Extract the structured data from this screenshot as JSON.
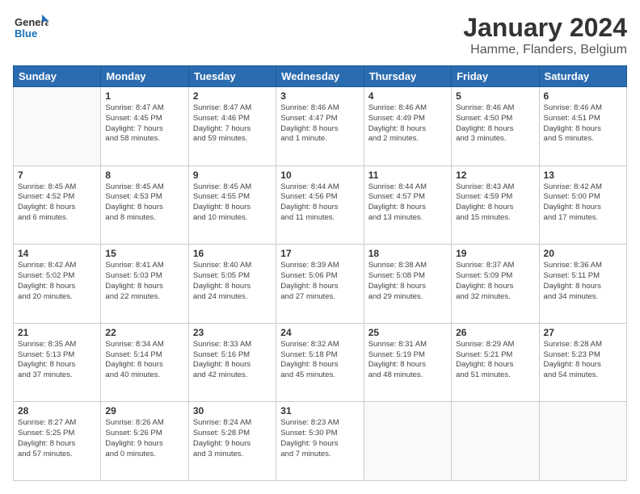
{
  "header": {
    "logo_general": "General",
    "logo_blue": "Blue",
    "title": "January 2024",
    "subtitle": "Hamme, Flanders, Belgium"
  },
  "days_of_week": [
    "Sunday",
    "Monday",
    "Tuesday",
    "Wednesday",
    "Thursday",
    "Friday",
    "Saturday"
  ],
  "weeks": [
    [
      {
        "day": "",
        "detail": ""
      },
      {
        "day": "1",
        "detail": "Sunrise: 8:47 AM\nSunset: 4:45 PM\nDaylight: 7 hours\nand 58 minutes."
      },
      {
        "day": "2",
        "detail": "Sunrise: 8:47 AM\nSunset: 4:46 PM\nDaylight: 7 hours\nand 59 minutes."
      },
      {
        "day": "3",
        "detail": "Sunrise: 8:46 AM\nSunset: 4:47 PM\nDaylight: 8 hours\nand 1 minute."
      },
      {
        "day": "4",
        "detail": "Sunrise: 8:46 AM\nSunset: 4:49 PM\nDaylight: 8 hours\nand 2 minutes."
      },
      {
        "day": "5",
        "detail": "Sunrise: 8:46 AM\nSunset: 4:50 PM\nDaylight: 8 hours\nand 3 minutes."
      },
      {
        "day": "6",
        "detail": "Sunrise: 8:46 AM\nSunset: 4:51 PM\nDaylight: 8 hours\nand 5 minutes."
      }
    ],
    [
      {
        "day": "7",
        "detail": "Sunrise: 8:45 AM\nSunset: 4:52 PM\nDaylight: 8 hours\nand 6 minutes."
      },
      {
        "day": "8",
        "detail": "Sunrise: 8:45 AM\nSunset: 4:53 PM\nDaylight: 8 hours\nand 8 minutes."
      },
      {
        "day": "9",
        "detail": "Sunrise: 8:45 AM\nSunset: 4:55 PM\nDaylight: 8 hours\nand 10 minutes."
      },
      {
        "day": "10",
        "detail": "Sunrise: 8:44 AM\nSunset: 4:56 PM\nDaylight: 8 hours\nand 11 minutes."
      },
      {
        "day": "11",
        "detail": "Sunrise: 8:44 AM\nSunset: 4:57 PM\nDaylight: 8 hours\nand 13 minutes."
      },
      {
        "day": "12",
        "detail": "Sunrise: 8:43 AM\nSunset: 4:59 PM\nDaylight: 8 hours\nand 15 minutes."
      },
      {
        "day": "13",
        "detail": "Sunrise: 8:42 AM\nSunset: 5:00 PM\nDaylight: 8 hours\nand 17 minutes."
      }
    ],
    [
      {
        "day": "14",
        "detail": "Sunrise: 8:42 AM\nSunset: 5:02 PM\nDaylight: 8 hours\nand 20 minutes."
      },
      {
        "day": "15",
        "detail": "Sunrise: 8:41 AM\nSunset: 5:03 PM\nDaylight: 8 hours\nand 22 minutes."
      },
      {
        "day": "16",
        "detail": "Sunrise: 8:40 AM\nSunset: 5:05 PM\nDaylight: 8 hours\nand 24 minutes."
      },
      {
        "day": "17",
        "detail": "Sunrise: 8:39 AM\nSunset: 5:06 PM\nDaylight: 8 hours\nand 27 minutes."
      },
      {
        "day": "18",
        "detail": "Sunrise: 8:38 AM\nSunset: 5:08 PM\nDaylight: 8 hours\nand 29 minutes."
      },
      {
        "day": "19",
        "detail": "Sunrise: 8:37 AM\nSunset: 5:09 PM\nDaylight: 8 hours\nand 32 minutes."
      },
      {
        "day": "20",
        "detail": "Sunrise: 8:36 AM\nSunset: 5:11 PM\nDaylight: 8 hours\nand 34 minutes."
      }
    ],
    [
      {
        "day": "21",
        "detail": "Sunrise: 8:35 AM\nSunset: 5:13 PM\nDaylight: 8 hours\nand 37 minutes."
      },
      {
        "day": "22",
        "detail": "Sunrise: 8:34 AM\nSunset: 5:14 PM\nDaylight: 8 hours\nand 40 minutes."
      },
      {
        "day": "23",
        "detail": "Sunrise: 8:33 AM\nSunset: 5:16 PM\nDaylight: 8 hours\nand 42 minutes."
      },
      {
        "day": "24",
        "detail": "Sunrise: 8:32 AM\nSunset: 5:18 PM\nDaylight: 8 hours\nand 45 minutes."
      },
      {
        "day": "25",
        "detail": "Sunrise: 8:31 AM\nSunset: 5:19 PM\nDaylight: 8 hours\nand 48 minutes."
      },
      {
        "day": "26",
        "detail": "Sunrise: 8:29 AM\nSunset: 5:21 PM\nDaylight: 8 hours\nand 51 minutes."
      },
      {
        "day": "27",
        "detail": "Sunrise: 8:28 AM\nSunset: 5:23 PM\nDaylight: 8 hours\nand 54 minutes."
      }
    ],
    [
      {
        "day": "28",
        "detail": "Sunrise: 8:27 AM\nSunset: 5:25 PM\nDaylight: 8 hours\nand 57 minutes."
      },
      {
        "day": "29",
        "detail": "Sunrise: 8:26 AM\nSunset: 5:26 PM\nDaylight: 9 hours\nand 0 minutes."
      },
      {
        "day": "30",
        "detail": "Sunrise: 8:24 AM\nSunset: 5:28 PM\nDaylight: 9 hours\nand 3 minutes."
      },
      {
        "day": "31",
        "detail": "Sunrise: 8:23 AM\nSunset: 5:30 PM\nDaylight: 9 hours\nand 7 minutes."
      },
      {
        "day": "",
        "detail": ""
      },
      {
        "day": "",
        "detail": ""
      },
      {
        "day": "",
        "detail": ""
      }
    ]
  ]
}
